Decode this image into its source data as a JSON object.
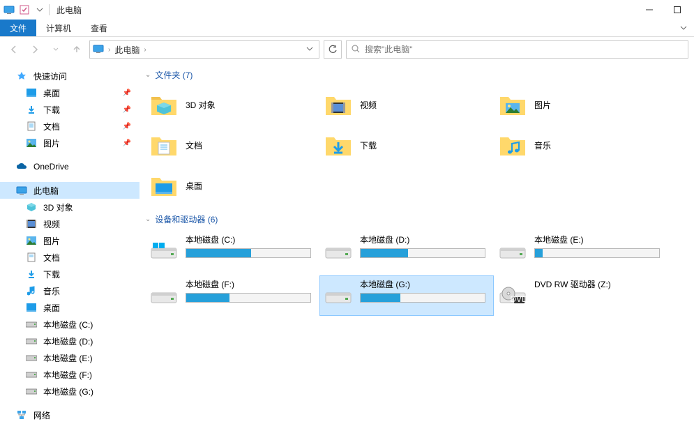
{
  "window": {
    "title": "此电脑"
  },
  "ribbon": {
    "file": "文件",
    "computer": "计算机",
    "view": "查看"
  },
  "address": {
    "crumb": "此电脑"
  },
  "search": {
    "placeholder": "搜索\"此电脑\""
  },
  "sidebar": {
    "quick_access": "快速访问",
    "desktop": "桌面",
    "downloads": "下载",
    "documents": "文档",
    "pictures": "图片",
    "onedrive": "OneDrive",
    "this_pc": "此电脑",
    "objects3d": "3D 对象",
    "videos": "视频",
    "pictures2": "图片",
    "documents2": "文档",
    "downloads2": "下载",
    "music": "音乐",
    "desktop2": "桌面",
    "disk_c": "本地磁盘 (C:)",
    "disk_d": "本地磁盘 (D:)",
    "disk_e": "本地磁盘 (E:)",
    "disk_f": "本地磁盘 (F:)",
    "disk_g": "本地磁盘 (G:)",
    "network": "网络"
  },
  "groups": {
    "folders": "文件夹 (7)",
    "drives": "设备和驱动器 (6)"
  },
  "folders": {
    "objects3d": "3D 对象",
    "videos": "视频",
    "pictures": "图片",
    "documents": "文档",
    "downloads": "下载",
    "music": "音乐",
    "desktop": "桌面"
  },
  "drives": {
    "c": {
      "name": "本地磁盘 (C:)",
      "fill_pct": 52
    },
    "d": {
      "name": "本地磁盘 (D:)",
      "fill_pct": 38
    },
    "e": {
      "name": "本地磁盘 (E:)",
      "fill_pct": 6
    },
    "f": {
      "name": "本地磁盘 (F:)",
      "fill_pct": 35
    },
    "g": {
      "name": "本地磁盘 (G:)",
      "fill_pct": 32,
      "selected": true
    },
    "dvd": {
      "name": "DVD RW 驱动器 (Z:)"
    }
  }
}
